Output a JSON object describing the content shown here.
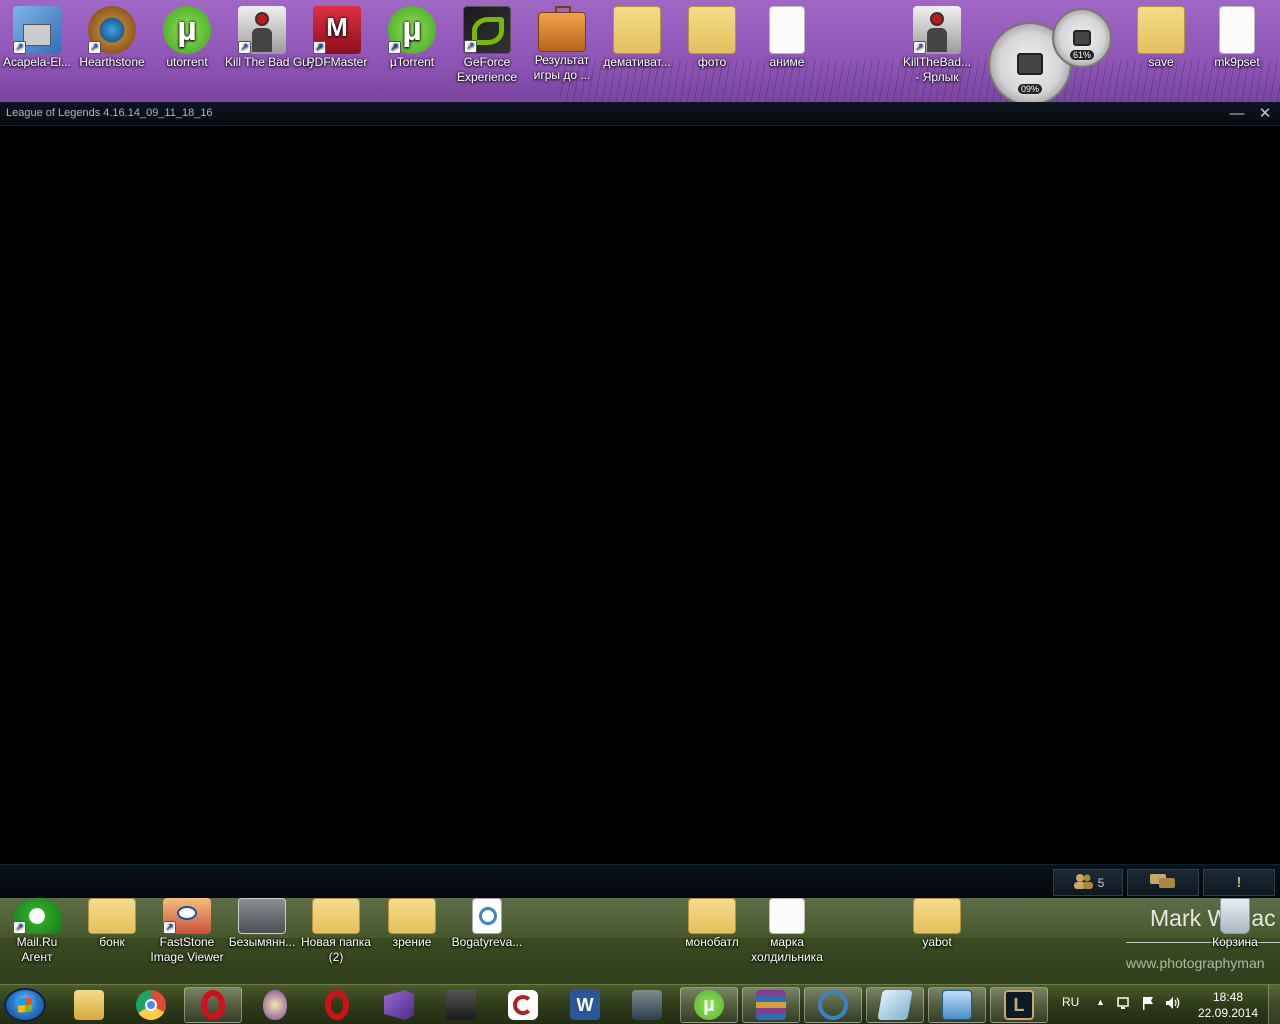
{
  "desktop_top_icons": [
    {
      "label": "Acapela-El...",
      "icon": "installer-icon",
      "color": "#2f6fb8"
    },
    {
      "label": "Hearthstone",
      "icon": "hearthstone-icon",
      "color": "#b5792b"
    },
    {
      "label": "utorrent",
      "icon": "utorrent-icon",
      "color": "#56b62c"
    },
    {
      "label": "Kill The Bad Guy",
      "icon": "killthebadguy-icon",
      "color": "#cccccc"
    },
    {
      "label": "PDFMaster",
      "icon": "pdfmaster-icon",
      "color": "#c0182c"
    },
    {
      "label": "µTorrent",
      "icon": "utorrent-icon",
      "color": "#56b62c"
    },
    {
      "label": "GeForce Experience",
      "icon": "geforce-icon",
      "color": "#76b900"
    },
    {
      "label": "Результат игры до ...",
      "icon": "briefcase-icon",
      "color": "#d88a2c"
    },
    {
      "label": "демативат...",
      "icon": "folder-icon",
      "color": "#e9c969"
    },
    {
      "label": "фото",
      "icon": "folder-icon",
      "color": "#e9c969"
    },
    {
      "label": "аниме",
      "icon": "document-icon",
      "color": "#ffffff"
    },
    {
      "label": "KillTheBad... - Ярлык",
      "icon": "killthebadguy-icon",
      "color": "#cccccc"
    },
    {
      "label": "save",
      "icon": "folder-icon",
      "color": "#e9c969"
    },
    {
      "label": "mk9pset",
      "icon": "document-icon",
      "color": "#ffffff"
    }
  ],
  "gadget": {
    "cpu_percent": "09%",
    "ram_percent": "61%"
  },
  "game_window": {
    "title": "League of Legends 4.16.14_09_11_18_16",
    "minimize": "—",
    "close": "✕",
    "friends_count": "5",
    "alert": "!"
  },
  "desktop_bottom_icons": [
    {
      "label": "Mail.Ru Агент",
      "icon": "mailru-agent-icon",
      "color": "#2aa826"
    },
    {
      "label": "бонк",
      "icon": "folder-icon",
      "color": "#e9c969"
    },
    {
      "label": "FastStone Image Viewer",
      "icon": "faststone-icon",
      "color": "#c8503a"
    },
    {
      "label": "Безымянн...",
      "icon": "image-file-icon",
      "color": "#6a6a6a"
    },
    {
      "label": "Новая папка (2)",
      "icon": "folder-icon",
      "color": "#e9c969"
    },
    {
      "label": "зрение",
      "icon": "folder-icon",
      "color": "#e9c969"
    },
    {
      "label": "Bogatyreva...",
      "icon": "molecule-file-icon",
      "color": "#3b82c4"
    },
    {
      "label": "монобатл",
      "icon": "folder-icon",
      "color": "#e9c969"
    },
    {
      "label": "марка холдильника",
      "icon": "document-icon",
      "color": "#ffffff"
    },
    {
      "label": "yabot",
      "icon": "folder-icon",
      "color": "#e9c969"
    },
    {
      "label": "Корзина",
      "icon": "recycle-bin-icon",
      "color": "#cfd8e0"
    }
  ],
  "wallpaper": {
    "name": "Mark Wallac",
    "url": "www.photographyman"
  },
  "taskbar": {
    "apps": [
      {
        "name": "explorer-icon",
        "color": "#e7c45a",
        "active": false
      },
      {
        "name": "chrome-icon",
        "color": "#dd4b39",
        "active": false
      },
      {
        "name": "opera-icon",
        "color": "#d0101c",
        "active": true
      },
      {
        "name": "tor-browser-icon",
        "color": "#7d4698",
        "active": false
      },
      {
        "name": "opera-icon",
        "color": "#d0101c",
        "active": false
      },
      {
        "name": "visual-studio-icon",
        "color": "#6a3fa0",
        "active": false
      },
      {
        "name": "game-avatar-icon",
        "color": "#3a3a3a",
        "active": false
      },
      {
        "name": "ccleaner-icon",
        "color": "#b22222",
        "active": false
      },
      {
        "name": "word-icon",
        "color": "#2b579a",
        "active": false
      },
      {
        "name": "warrior-game-icon",
        "color": "#2c3e50",
        "active": false
      },
      {
        "name": "utorrent-icon",
        "color": "#56b62c",
        "active": true
      },
      {
        "name": "winrar-icon",
        "color": "#8a3b8f",
        "active": true
      },
      {
        "name": "molecule-app-icon",
        "color": "#3b82c4",
        "active": true
      },
      {
        "name": "notepad-icon",
        "color": "#9fd0e8",
        "active": true
      },
      {
        "name": "control-panel-icon",
        "color": "#4a8cc9",
        "active": true
      },
      {
        "name": "league-of-legends-icon",
        "color": "#c9a865",
        "active": true
      }
    ],
    "language": "RU",
    "time": "18:48",
    "date": "22.09.2014"
  }
}
